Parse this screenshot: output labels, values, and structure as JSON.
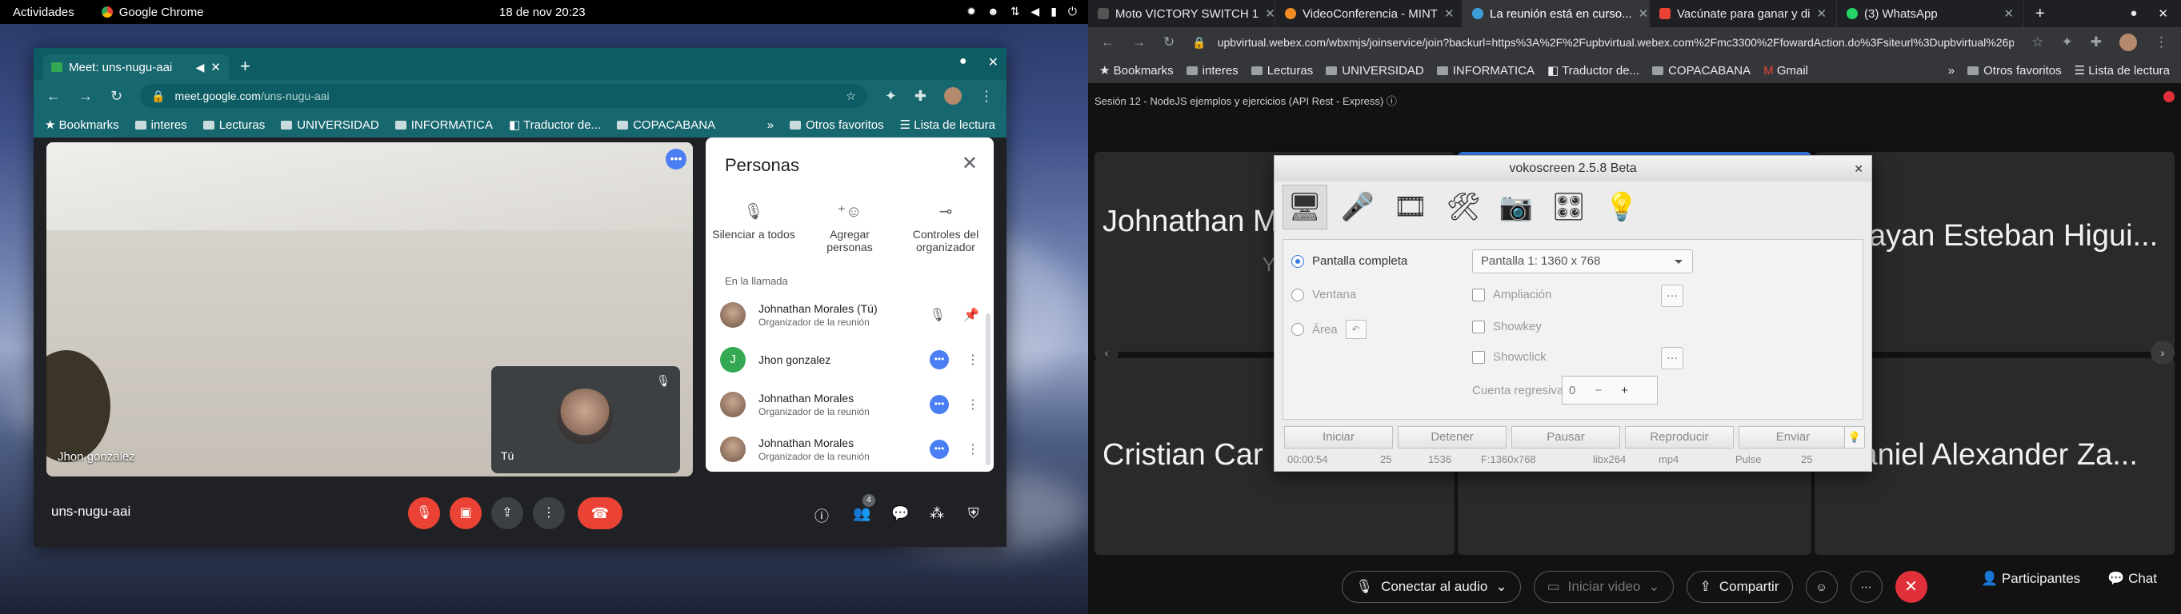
{
  "topbar": {
    "activities": "Actividades",
    "app": "Google Chrome",
    "clock": "18 de nov  20:23"
  },
  "meet_window": {
    "tab_title": "Meet: uns-nugu-aai",
    "url_domain": "meet.google.com",
    "url_path": "/uns-nugu-aai",
    "bookmarks": [
      "Bookmarks",
      "interes",
      "Lecturas",
      "UNIVERSIDAD",
      "INFORMATICA",
      "Traductor de...",
      "COPACABANA"
    ],
    "bookmarks_right": [
      "Otros favoritos",
      "Lista de lectura"
    ],
    "main_tile_name": "Jhon gonzalez",
    "self_tile_name": "Tú",
    "meeting_code": "uns-nugu-aai",
    "people_count": "4",
    "panel": {
      "title": "Personas",
      "actions": [
        "Silenciar a todos",
        "Agregar personas",
        "Controles del organizador"
      ],
      "section_label": "En la llamada",
      "participants": [
        {
          "name": "Johnathan Morales (Tú)",
          "role": "Organizador de la reunión"
        },
        {
          "name": "Jhon gonzalez",
          "role": "",
          "initial": "J"
        },
        {
          "name": "Johnathan Morales",
          "role": "Organizador de la reunión"
        },
        {
          "name": "Johnathan Morales",
          "role": "Organizador de la reunión"
        }
      ]
    }
  },
  "webex_window": {
    "tabs": [
      "Moto VICTORY SWITCH 1",
      "VideoConferencia - MINT",
      "La reunión está en curso...",
      "Vacúnate para ganar y di",
      "(3) WhatsApp"
    ],
    "url": "upbvirtual.webex.com/wbxmjs/joinservice/join?backurl=https%3A%2F%2Fupbvirtual.webex.com%2Fmc3300%2FfowardAction.do%3Fsiteurl%3Dupbvirtual%26pgvD...",
    "bookmarks": [
      "Bookmarks",
      "interes",
      "Lecturas",
      "UNIVERSIDAD",
      "INFORMATICA",
      "Traductor de...",
      "COPACABANA",
      "Gmail"
    ],
    "bookmarks_right": [
      "Otros favoritos",
      "Lista de lectura"
    ],
    "session_title": "Sesión 12 - NodeJS ejemplos y ejercicios (API Rest - Express)",
    "tiles": [
      "Johnathan M",
      "Brayan Esteban Higui...",
      "Cristian Car",
      "Daniel Alexander Za..."
    ],
    "tile_sub": "Y",
    "controls": {
      "audio": "Conectar al audio",
      "video": "Iniciar video",
      "share": "Compartir",
      "participants": "Participantes",
      "chat": "Chat"
    }
  },
  "vokoscreen": {
    "title": "vokoscreen 2.5.8 Beta",
    "modes": [
      "Pantalla completa",
      "Ventana",
      "Área"
    ],
    "screen_select": "Pantalla 1:  1360 x 768",
    "options": [
      "Ampliación",
      "Showkey",
      "Showclick"
    ],
    "countdown_label": "Cuenta regresiva",
    "countdown_value": "0",
    "buttons": [
      "Iniciar",
      "Detener",
      "Pausar",
      "Reproducir",
      "Enviar"
    ],
    "stats": [
      "00:00:54",
      "25",
      "1536",
      "F:1360x768",
      "libx264",
      "mp4",
      "Pulse",
      "25"
    ]
  }
}
